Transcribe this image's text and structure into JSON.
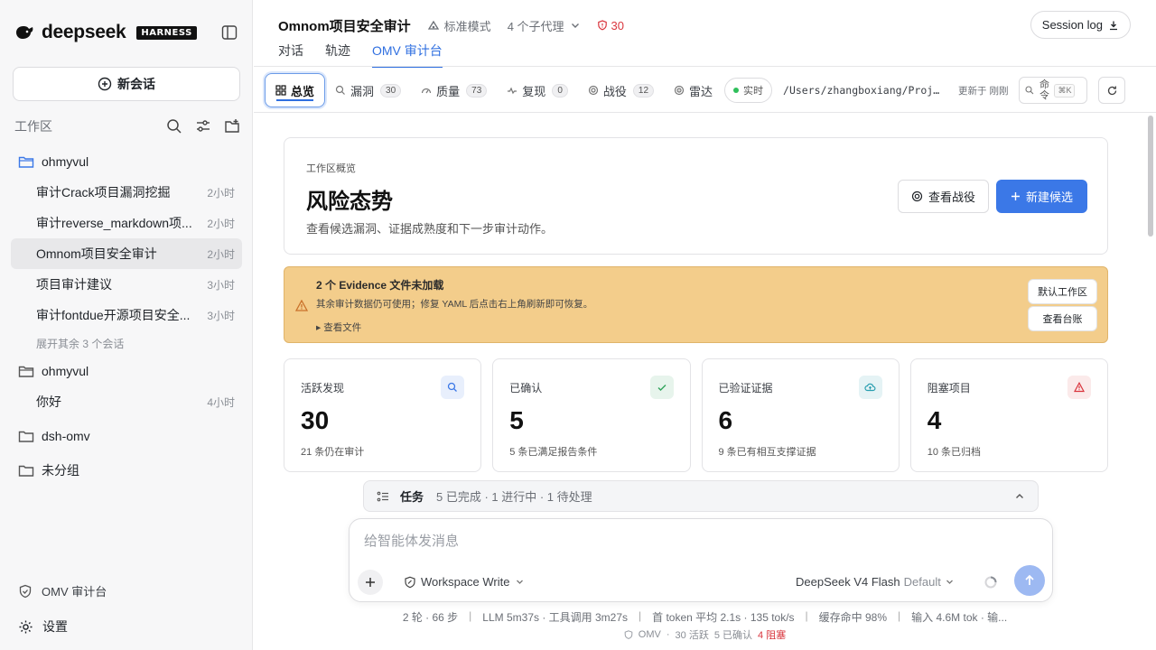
{
  "app": {
    "brand": "deepseek",
    "badge": "HARNESS"
  },
  "sidebar": {
    "new_chat": "新会话",
    "workspace_title": "工作区",
    "groups": [
      {
        "name": "ohmyvul",
        "sessions": [
          {
            "title": "审计Crack项目漏洞挖掘",
            "time": "2小时"
          },
          {
            "title": "审计reverse_markdown项...",
            "time": "2小时"
          },
          {
            "title": "Omnom项目安全审计",
            "time": "2小时"
          },
          {
            "title": "项目审计建议",
            "time": "3小时"
          },
          {
            "title": "审计fontdue开源项目安全...",
            "time": "3小时"
          }
        ],
        "expand": "展开其余 3 个会话"
      },
      {
        "name": "ohmyvul",
        "sessions": [
          {
            "title": "你好",
            "time": "4小时"
          }
        ]
      },
      {
        "name": "dsh-omv"
      },
      {
        "name": "未分组"
      }
    ],
    "footer": {
      "omv": "OMV 审计台",
      "settings": "设置"
    }
  },
  "header": {
    "project": "Omnom项目安全审计",
    "mode": "标准模式",
    "agents": "4 个子代理",
    "risk_count": "30",
    "session_log": "Session log",
    "tabs": [
      "对话",
      "轨迹",
      "OMV 审计台"
    ]
  },
  "subtabs": {
    "items": [
      {
        "label": "总览"
      },
      {
        "label": "漏洞",
        "count": "30"
      },
      {
        "label": "质量",
        "count": "73"
      },
      {
        "label": "复现",
        "count": "0"
      },
      {
        "label": "战役",
        "count": "12"
      },
      {
        "label": "雷达"
      }
    ],
    "live": "实时",
    "path": "/Users/zhangboxiang/Projects/omnom",
    "updated": "更新于 刚刚",
    "command": "命令",
    "shortcut": "⌘K"
  },
  "overview": {
    "eyebrow": "工作区概览",
    "title": "风险态势",
    "description": "查看候选漏洞、证据成熟度和下一步审计动作。",
    "view_campaign": "查看战役",
    "new_candidate": "新建候选"
  },
  "warning": {
    "title": "2 个 Evidence 文件未加载",
    "body": "其余审计数据仍可使用；修复 YAML 后点击右上角刷新即可恢复。",
    "files": "▸ 查看文件",
    "default_ws": "默认工作区",
    "ledger": "查看台账"
  },
  "stats": [
    {
      "label": "活跃发现",
      "value": "30",
      "sub": "21 条仍在审计",
      "icon": "search-icon",
      "color": "#3b78e7",
      "bg": "#e8effc"
    },
    {
      "label": "已确认",
      "value": "5",
      "sub": "5 条已满足报告条件",
      "icon": "check-icon",
      "color": "#2fa35a",
      "bg": "#e7f4ec"
    },
    {
      "label": "已验证证据",
      "value": "6",
      "sub": "9 条已有相互支撑证据",
      "icon": "cloud-icon",
      "color": "#2a9fb0",
      "bg": "#e5f3f5"
    },
    {
      "label": "阻塞项目",
      "value": "4",
      "sub": "10 条已归档",
      "icon": "alert-icon",
      "color": "#d9363e",
      "bg": "#fbeaea"
    }
  ],
  "tasks": {
    "title": "任务",
    "summary": "5 已完成 · 1 进行中 · 1 待处理"
  },
  "composer": {
    "placeholder": "给智能体发消息",
    "permission": "Workspace Write",
    "model": "DeepSeek V4 Flash",
    "model_default": "Default"
  },
  "metrics": {
    "turns": "2 轮 · 66 步",
    "llm": "LLM 5m37s · 工具调用 3m27s",
    "first_token": "首 token 平均 2.1s · 135 tok/s",
    "cache": "缓存命中 98%",
    "input": "输入 4.6M tok · 输..."
  },
  "status": {
    "omv": "OMV",
    "active": "30 活跃",
    "confirmed": "5 已确认",
    "blocked": "4 阻塞"
  }
}
